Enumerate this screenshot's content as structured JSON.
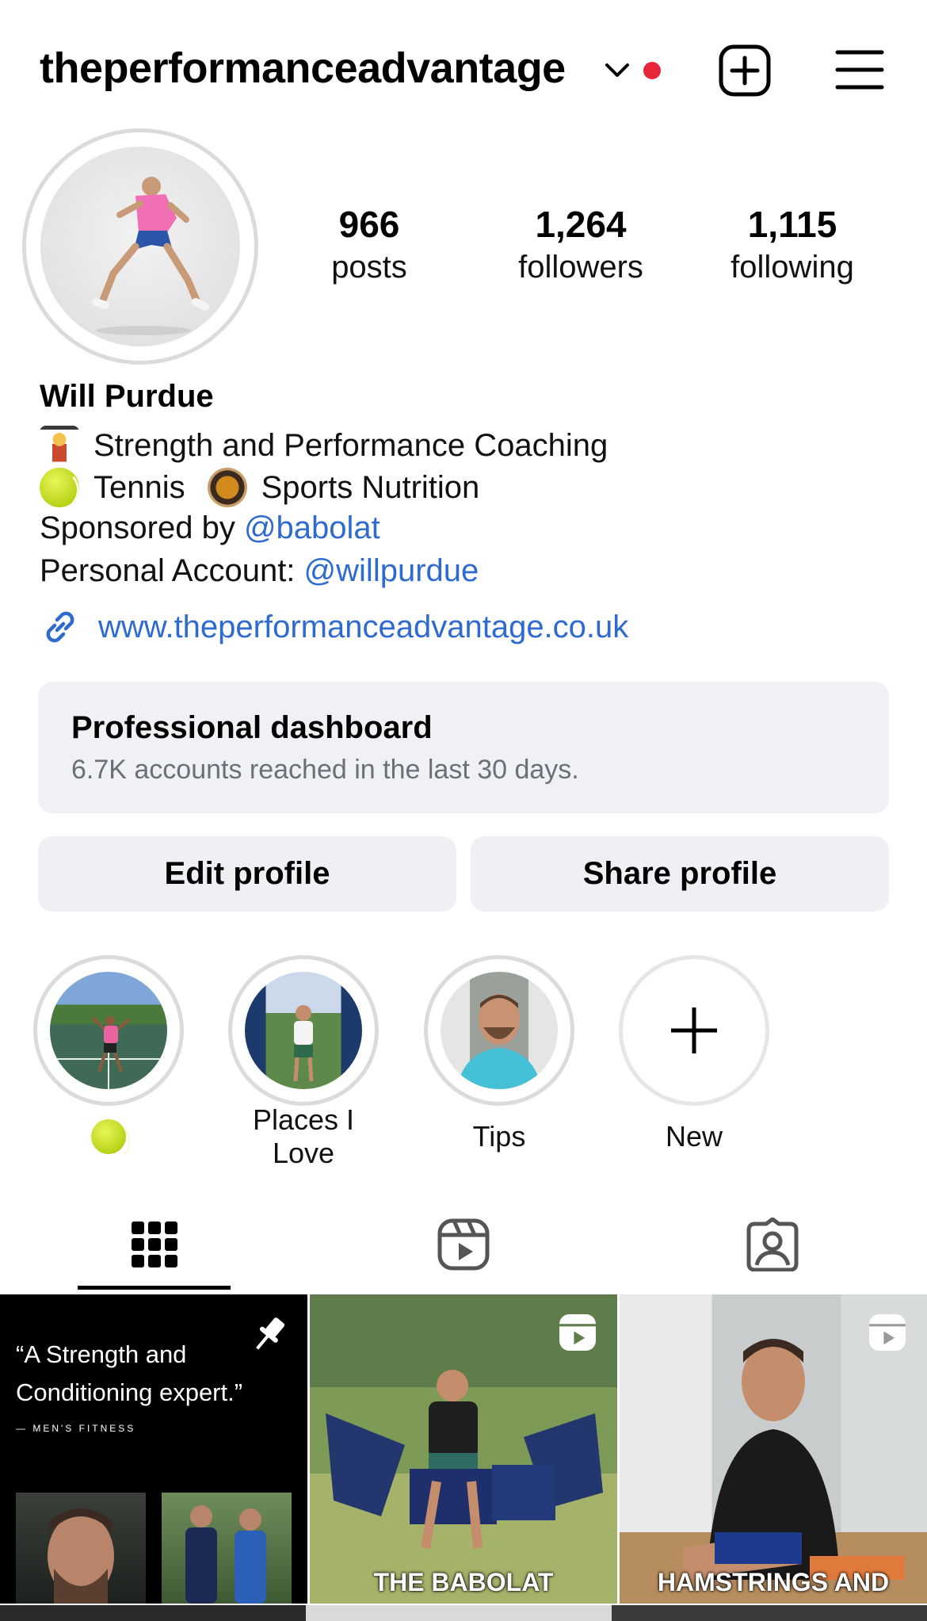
{
  "header": {
    "username": "theperformanceadvantage"
  },
  "stats": [
    {
      "value": "966",
      "label": "posts"
    },
    {
      "value": "1,264",
      "label": "followers"
    },
    {
      "value": "1,115",
      "label": "following"
    }
  ],
  "bio": {
    "name": "Will Purdue",
    "line1": "Strength and Performance Coaching",
    "line2a": "Tennis",
    "line2b": "Sports Nutrition",
    "sponsored_prefix": "Sponsored by ",
    "sponsored_handle": "@babolat",
    "personal_prefix": "Personal Account: ",
    "personal_handle": "@willpurdue",
    "website": "www.theperformanceadvantage.co.uk"
  },
  "dashboard": {
    "title": "Professional dashboard",
    "subtitle": "6.7K accounts reached in the last 30 days."
  },
  "buttons": {
    "edit": "Edit profile",
    "share": "Share profile"
  },
  "highlights": [
    {
      "label": ""
    },
    {
      "label": "Places I Love"
    },
    {
      "label": "Tips"
    },
    {
      "label": "New"
    }
  ],
  "posts": {
    "p1_quote": "“A Strength and Conditioning expert.”",
    "p1_source": "— MEN'S FITNESS",
    "p2_caption": "THE BABOLAT",
    "p3_caption": "HAMSTRINGS AND"
  },
  "colors": {
    "link": "#2e6ad0",
    "notification_dot": "#e8263a"
  }
}
